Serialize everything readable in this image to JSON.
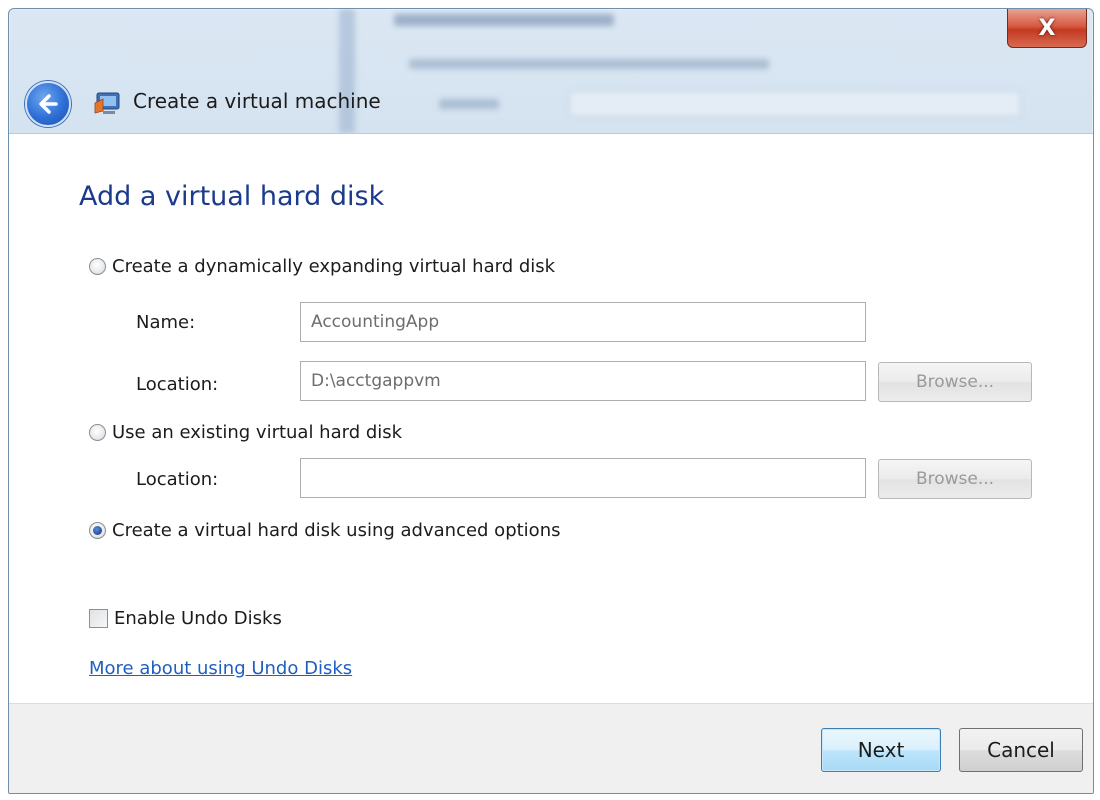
{
  "window": {
    "title": "Create a virtual machine",
    "close_label": "X",
    "icons": {
      "back": "back-arrow-icon",
      "app": "virtual-pc-icon"
    }
  },
  "page": {
    "heading": "Add a virtual hard disk"
  },
  "options": {
    "dynamic": {
      "label": "Create a dynamically expanding virtual hard disk",
      "selected": false,
      "name_label": "Name:",
      "name_value": "AccountingApp",
      "location_label": "Location:",
      "location_value": "D:\\acctgappvm",
      "browse_label": "Browse..."
    },
    "existing": {
      "label": "Use an existing virtual hard disk",
      "selected": false,
      "location_label": "Location:",
      "location_value": "",
      "browse_label": "Browse..."
    },
    "advanced": {
      "label": "Create a virtual hard disk using advanced options",
      "selected": true
    }
  },
  "undo": {
    "checkbox_label": "Enable Undo Disks",
    "checked": false,
    "link_text": "More about using Undo Disks"
  },
  "footer": {
    "next_label": "Next",
    "cancel_label": "Cancel"
  },
  "colors": {
    "heading": "#1b3a8c",
    "link": "#1f5fc2",
    "close_button": "#c23a22",
    "next_border": "#3c7fb1"
  }
}
